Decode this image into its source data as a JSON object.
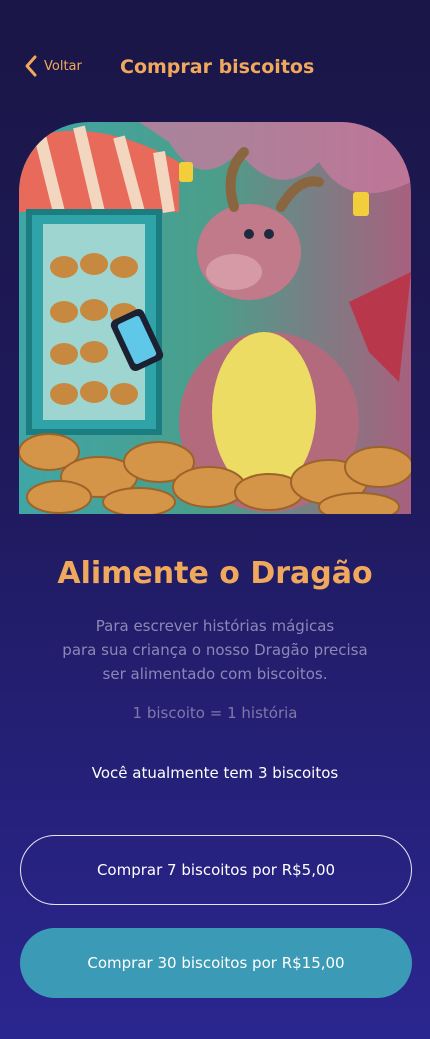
{
  "header": {
    "back_label": "Voltar",
    "title": "Comprar biscoitos"
  },
  "hero": {
    "image": "dragon-cookie-shop-illustration"
  },
  "content": {
    "heading": "Alimente o Dragão",
    "description_lines": [
      "Para escrever histórias mágicas",
      "para sua criança o nosso Dragão precisa",
      "ser alimentado com biscoitos."
    ],
    "rate": "1 biscoito = 1 história",
    "current_balance": "Você atualmente tem 3 biscoitos"
  },
  "buttons": {
    "buy_small": "Comprar 7 biscoitos por R$5,00",
    "buy_large": "Comprar 30 biscoitos por R$15,00"
  },
  "colors": {
    "accent": "#f0a85c",
    "button_primary": "#3b9bb6",
    "background_top": "#1a1646",
    "background_bottom": "#2a2690"
  }
}
